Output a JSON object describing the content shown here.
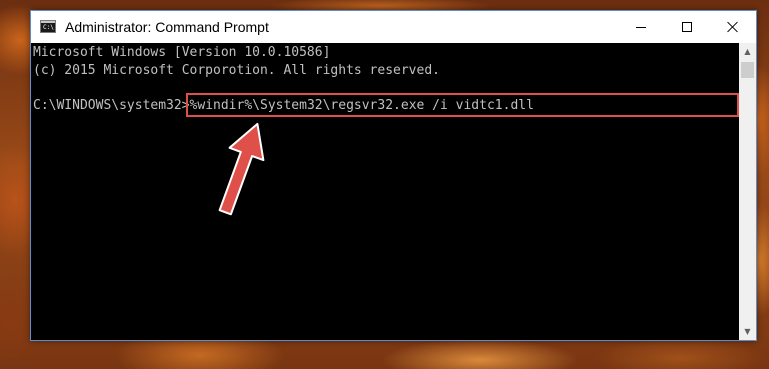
{
  "window": {
    "title": "Administrator: Command Prompt",
    "icon_text": "C:\\",
    "controls": {
      "minimize": "minimize-icon",
      "maximize": "maximize-icon",
      "close": "close-icon"
    }
  },
  "console": {
    "lines": [
      "Microsoft Windows [Version 10.0.10586]",
      "(c) 2015 Microsoft Corporotion. All rights reserved."
    ],
    "prompt": "C:\\WINDOWS\\system32>",
    "command": "%windir%\\System32\\regsvr32.exe /i vidtc1.dll"
  },
  "annotation": {
    "highlight_color": "#e0504a",
    "arrow_color": "#e0504a"
  },
  "scrollbar": {
    "up_icon": "▲",
    "down_icon": "▼"
  }
}
